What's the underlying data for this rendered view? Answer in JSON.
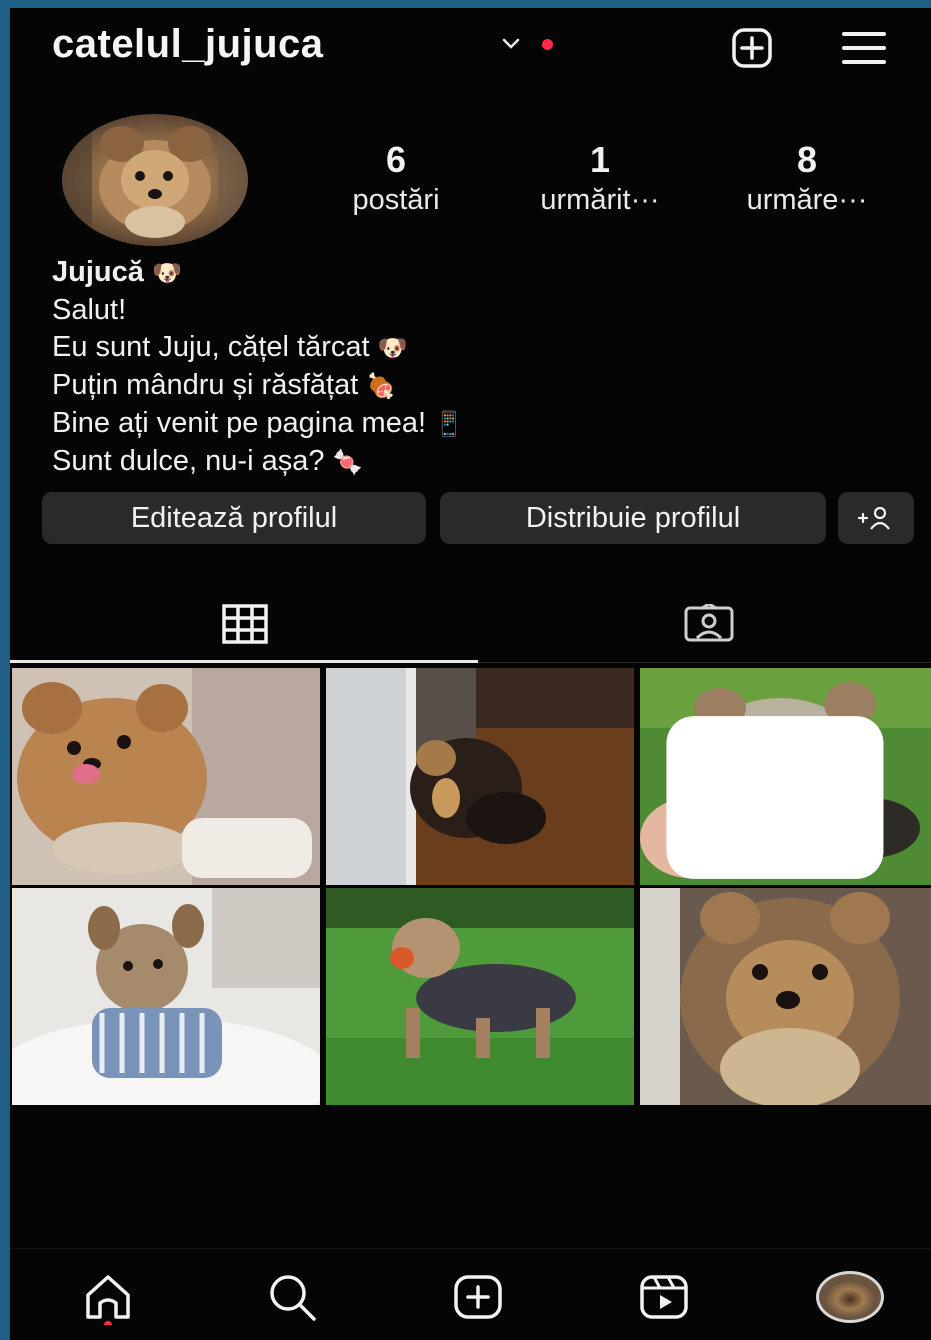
{
  "header": {
    "username": "catelul_jujuca",
    "icons": [
      "chevron-down-icon",
      "notification-dot",
      "add-post-icon",
      "menu-icon"
    ]
  },
  "profile": {
    "stats": [
      {
        "value": "6",
        "label": "postări"
      },
      {
        "value": "1",
        "label": "urmărit···"
      },
      {
        "value": "8",
        "label": "urmăre···"
      }
    ],
    "bio": {
      "name": "Jujucă",
      "lines": [
        "Salut!",
        "Eu sunt Juju, cățel tărcat",
        "Puțin mândru și răsfățat",
        "Bine ați venit pe pagina mea!",
        "Sunt dulce, nu-i așa?"
      ],
      "emoji": [
        "🐶",
        "🐶",
        "🍖",
        "📱",
        "🍬"
      ]
    }
  },
  "buttons": {
    "edit": "Editează profilul",
    "share": "Distribuie profilul",
    "add_person": "add-person-icon"
  },
  "tabs": [
    {
      "icon": "grid-icon",
      "selected": true
    },
    {
      "icon": "tagged-icon",
      "selected": false
    }
  ],
  "posts": [
    {
      "subject": "yorkie licking",
      "multi": false
    },
    {
      "subject": "yorkie at window",
      "multi": false
    },
    {
      "subject": "yorkie eating treat",
      "multi": true
    },
    {
      "subject": "yorkie in striped shirt",
      "multi": false
    },
    {
      "subject": "yorkie on grass with ball",
      "multi": false
    },
    {
      "subject": "yorkie portrait",
      "multi": false
    }
  ],
  "bottom_nav": [
    "home-icon",
    "search-icon",
    "create-icon",
    "reels-icon",
    "profile-avatar"
  ],
  "colors": {
    "background": "#050505",
    "frame": "#1f5f86",
    "accent_dot": "#ff2a45",
    "button": "#2a2a2a"
  }
}
